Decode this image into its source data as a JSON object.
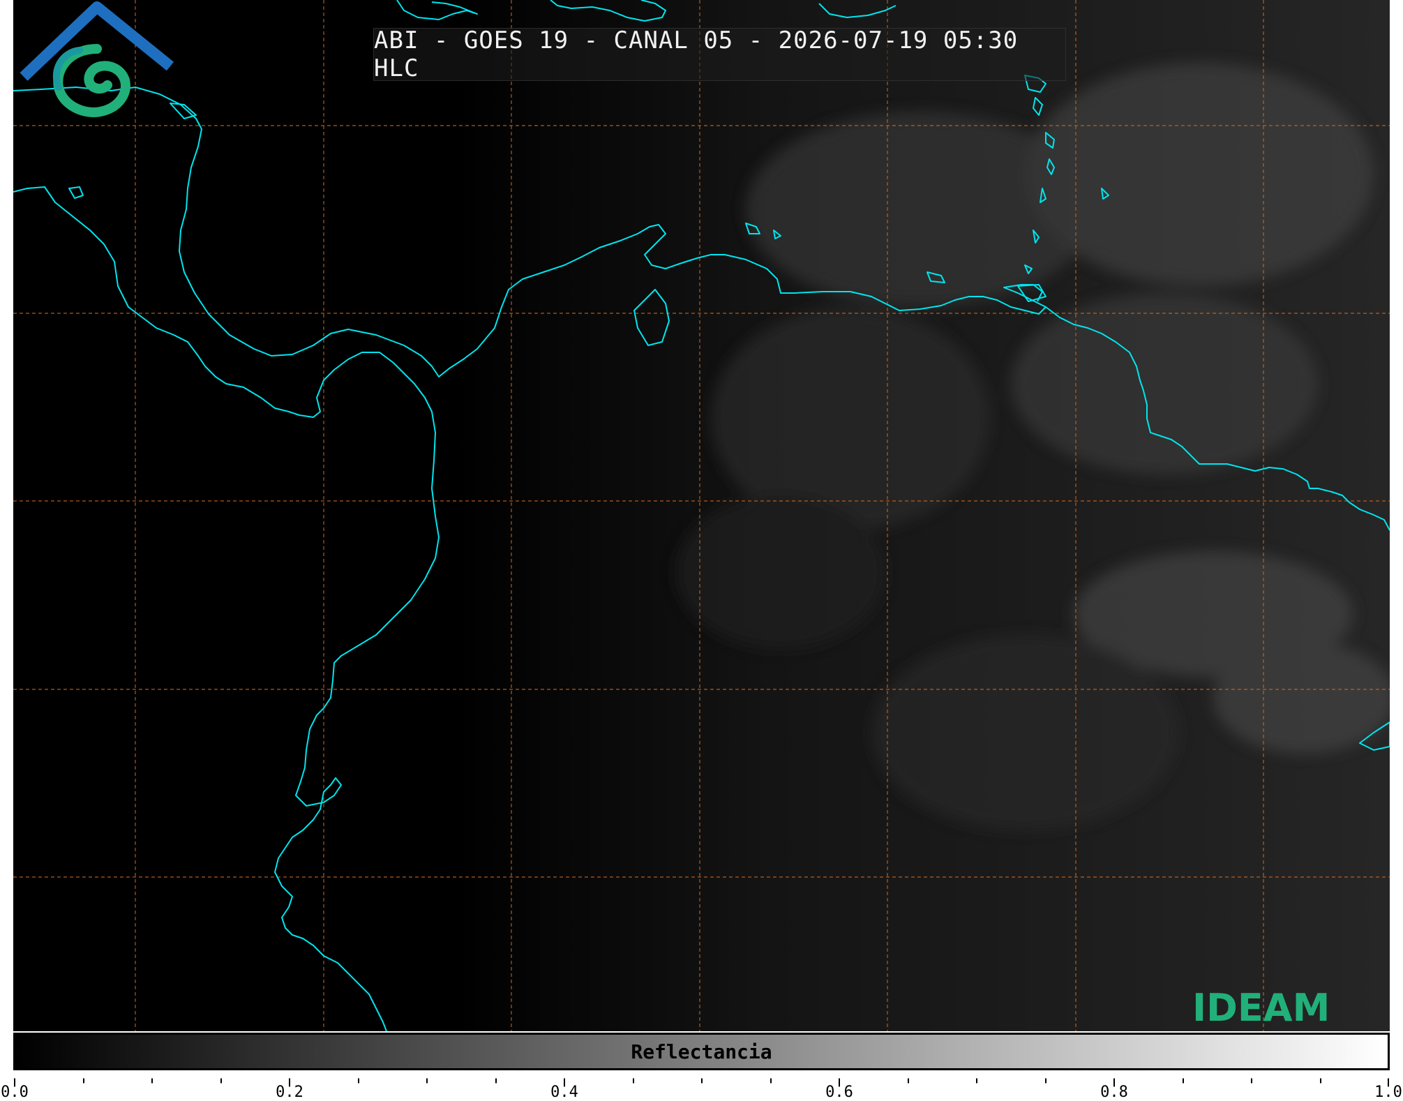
{
  "title": "ABI - GOES 19 - CANAL 05 - 2026-07-19 05:30 HLC",
  "colorbar": {
    "label": "Reflectancia",
    "ticks": [
      "0.0",
      "0.2",
      "0.4",
      "0.6",
      "0.8",
      "1.0"
    ],
    "range": [
      0.0,
      1.0
    ],
    "colormap": "grayscale"
  },
  "logo": {
    "text": "IDEAM"
  },
  "colors": {
    "background": "#000000",
    "coastline": "#00e5ee",
    "gridlines": "#d2691e",
    "logo_green": "#21b07a",
    "logo_blue": "#1f6fc0"
  }
}
